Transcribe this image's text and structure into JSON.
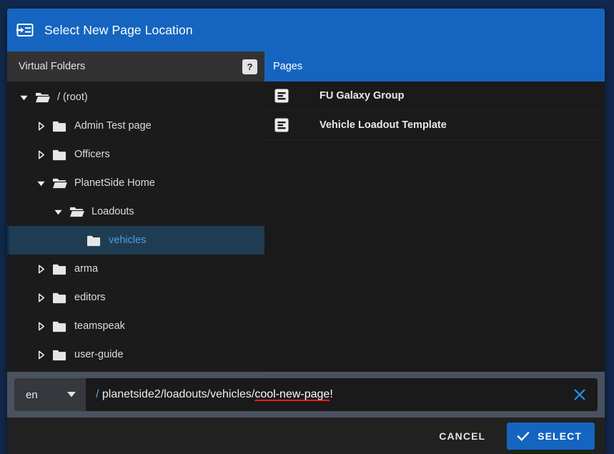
{
  "dialog": {
    "title": "Select New Page Location",
    "title_icon": "page-insert-icon"
  },
  "folders_panel": {
    "header": "Virtual Folders",
    "help_label": "?",
    "tree": [
      {
        "label": "/ (root)",
        "depth": 0,
        "state": "expanded",
        "selected": false,
        "icon": "folder-open-icon"
      },
      {
        "label": "Admin Test page",
        "depth": 1,
        "state": "collapsed",
        "selected": false,
        "icon": "folder-icon"
      },
      {
        "label": "Officers",
        "depth": 1,
        "state": "collapsed",
        "selected": false,
        "icon": "folder-icon"
      },
      {
        "label": "PlanetSide Home",
        "depth": 1,
        "state": "expanded",
        "selected": false,
        "icon": "folder-open-icon"
      },
      {
        "label": "Loadouts",
        "depth": 2,
        "state": "expanded",
        "selected": false,
        "icon": "folder-open-icon"
      },
      {
        "label": "vehicles",
        "depth": 3,
        "state": "leaf",
        "selected": true,
        "icon": "folder-icon"
      },
      {
        "label": "arma",
        "depth": 1,
        "state": "collapsed",
        "selected": false,
        "icon": "folder-icon"
      },
      {
        "label": "editors",
        "depth": 1,
        "state": "collapsed",
        "selected": false,
        "icon": "folder-icon"
      },
      {
        "label": "teamspeak",
        "depth": 1,
        "state": "collapsed",
        "selected": false,
        "icon": "folder-icon"
      },
      {
        "label": "user-guide",
        "depth": 1,
        "state": "collapsed",
        "selected": false,
        "icon": "folder-icon"
      }
    ]
  },
  "pages_panel": {
    "header": "Pages",
    "items": [
      {
        "label": "FU Galaxy Group",
        "icon": "page-icon"
      },
      {
        "label": "Vehicle Loadout Template",
        "icon": "page-icon"
      }
    ]
  },
  "path_bar": {
    "locale": "en",
    "locale_caret_icon": "chevron-down-icon",
    "path_prefix": "/",
    "path_base": " planetside2/loadouts/vehicles/",
    "path_new_segment": "cool-new-page",
    "path_suffix": "!",
    "clear_icon": "close-icon"
  },
  "footer": {
    "cancel_label": "CANCEL",
    "select_label": "SELECT",
    "select_icon": "check-icon"
  },
  "colors": {
    "accent_blue": "#1565c0",
    "selected_row_bg": "#1e3d52",
    "selected_row_text": "#4b9fea",
    "spellcheck_red": "#ff1a1a",
    "panel_dark": "#1b1b1b",
    "header_grey": "#323232",
    "pathbar_grey": "#4a5260",
    "backdrop_navy": "#12294d"
  }
}
